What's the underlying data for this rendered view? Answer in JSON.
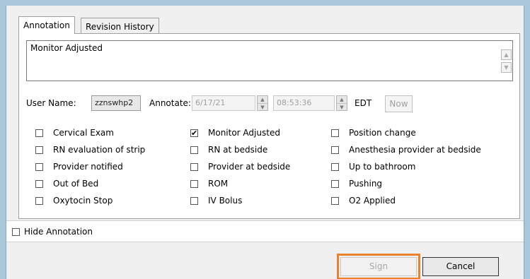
{
  "tabs": [
    {
      "label": "Annotation",
      "active": true
    },
    {
      "label": "Revision History",
      "active": false
    }
  ],
  "annotation_text": "Monitor Adjusted",
  "user": {
    "label": "User Name:",
    "value": "zznswhp2"
  },
  "annotate": {
    "label": "Annotate:",
    "date": "6/17/21",
    "time": "08:53:36",
    "timezone": "EDT",
    "now_label": "Now"
  },
  "checkboxes": [
    {
      "label": "Cervical Exam",
      "checked": false
    },
    {
      "label": "RN evaluation of strip",
      "checked": false
    },
    {
      "label": "Provider notified",
      "checked": false
    },
    {
      "label": "Out of Bed",
      "checked": false
    },
    {
      "label": "Oxytocin Stop",
      "checked": false
    },
    {
      "label": "Monitor Adjusted",
      "checked": true
    },
    {
      "label": "RN at bedside",
      "checked": false
    },
    {
      "label": "Provider at bedside",
      "checked": false
    },
    {
      "label": "ROM",
      "checked": false
    },
    {
      "label": "IV Bolus",
      "checked": false
    },
    {
      "label": "Position change",
      "checked": false
    },
    {
      "label": "Anesthesia provider at bedside",
      "checked": false
    },
    {
      "label": "Up to bathroom",
      "checked": false
    },
    {
      "label": "Pushing",
      "checked": false
    },
    {
      "label": "O2 Applied",
      "checked": false
    }
  ],
  "hide_annotation": {
    "label": "Hide Annotation",
    "checked": false
  },
  "buttons": {
    "sign": "Sign",
    "cancel": "Cancel"
  },
  "colors": {
    "highlight": "#e8822e",
    "window_border": "#a9c6da"
  }
}
